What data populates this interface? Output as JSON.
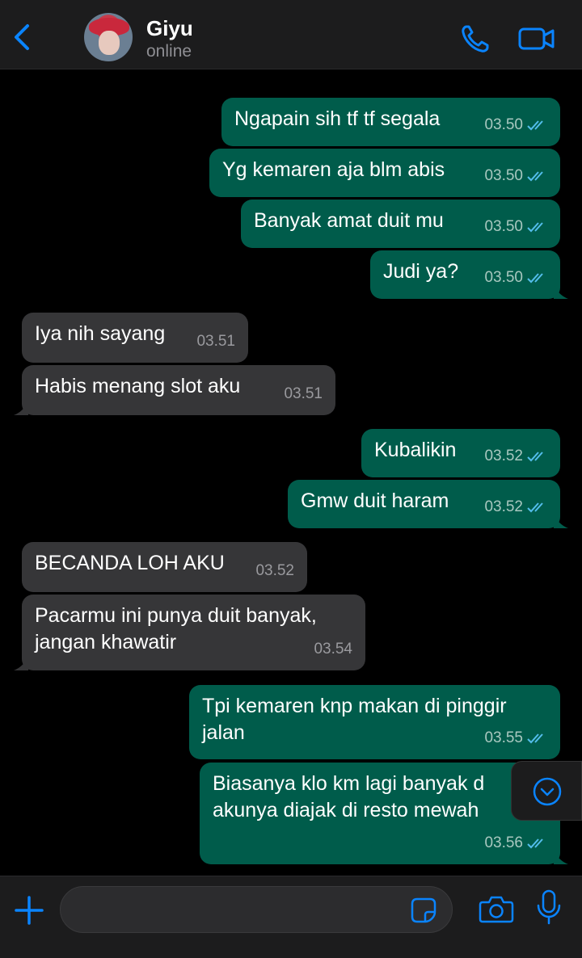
{
  "header": {
    "contact_name": "Giyu",
    "status": "online"
  },
  "messages": [
    {
      "dir": "out",
      "text": "Ngapain sih tf tf segala",
      "time": "03.50",
      "read": true
    },
    {
      "dir": "out",
      "text": "Yg kemaren aja blm abis",
      "time": "03.50",
      "read": true
    },
    {
      "dir": "out",
      "text": "Banyak amat duit mu",
      "time": "03.50",
      "read": true
    },
    {
      "dir": "out",
      "text": "Judi ya?",
      "time": "03.50",
      "read": true
    },
    {
      "dir": "in",
      "text": "Iya nih sayang",
      "time": "03.51"
    },
    {
      "dir": "in",
      "text": "Habis menang slot aku",
      "time": "03.51"
    },
    {
      "dir": "out",
      "text": "Kubalikin",
      "time": "03.52",
      "read": true
    },
    {
      "dir": "out",
      "text": "Gmw duit haram",
      "time": "03.52",
      "read": true
    },
    {
      "dir": "in",
      "text": "BECANDA LOH AKU",
      "time": "03.52"
    },
    {
      "dir": "in",
      "text": "Pacarmu ini punya duit banyak, jangan khawatir",
      "time": "03.54"
    },
    {
      "dir": "out",
      "text": "Tpi kemaren knp makan di pinggir jalan",
      "time": "03.55",
      "read": true
    },
    {
      "dir": "out",
      "text": "Biasanya klo km lagi banyak d akunya diajak di resto mewah",
      "time": "03.56",
      "read": true
    }
  ],
  "input": {
    "placeholder": ""
  },
  "colors": {
    "accent": "#0a84ff",
    "outgoing_bubble": "#005c4b",
    "incoming_bubble": "#363638",
    "read_ticks": "#53bdeb"
  }
}
